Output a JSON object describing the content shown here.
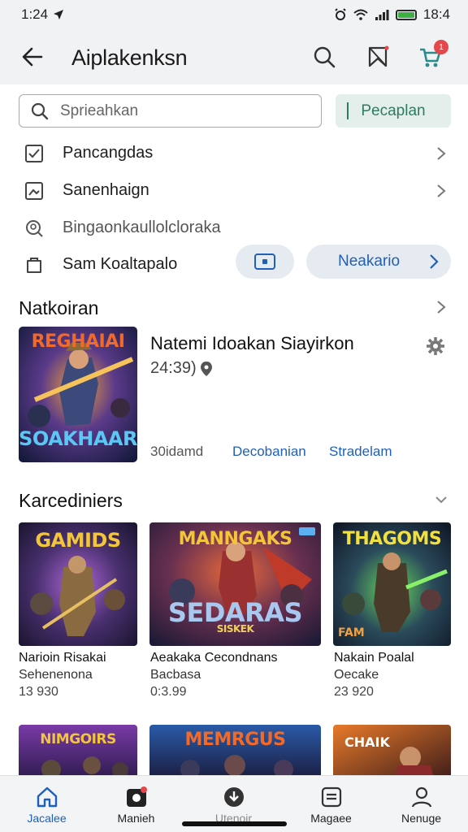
{
  "status": {
    "time_left": "1:24",
    "time_right": "18:4",
    "battery_color": "#3cb043"
  },
  "appbar": {
    "title": "Aiplakenksn",
    "cart_badge": "1",
    "icons": [
      "back-arrow-icon",
      "search-icon",
      "bookmark-icon",
      "cart-icon"
    ]
  },
  "search": {
    "placeholder": "Sprieahkan",
    "button_label": "Pecaplan"
  },
  "menu": [
    {
      "label": "Pancangdas",
      "icon": "checkbox-icon"
    },
    {
      "label": "Sanenhaign",
      "icon": "image-icon"
    },
    {
      "label": "Bingaonkaullolcloraka",
      "icon": "search-person-icon"
    },
    {
      "label": "Sam Koaltapalo",
      "icon": "bag-icon"
    }
  ],
  "pills": {
    "pill2_label": "Neakario"
  },
  "featured": {
    "heading": "Natkoiran",
    "title": "Natemi Idoakan Siayirkon",
    "meta": "24:39)",
    "foot_1": "30idamd",
    "foot_2": "Decobanian",
    "foot_3": "Stradelam",
    "art_top": "REGHAIAI",
    "art_bottom": "SOAKHAAR"
  },
  "collection": {
    "heading": "Karcediniers",
    "cards": [
      {
        "title": "Narioin Risakai",
        "subtitle": "Sehenenona",
        "price": "13 930",
        "art": "GAMIDS"
      },
      {
        "title": "Aeakaka Cecondnans",
        "subtitle": "Bacbasa",
        "price": "0:3.99",
        "art": "MANNGAKS",
        "art2": "SEDARAS",
        "art3": "SISKEK"
      },
      {
        "title": "Nakain Poalal",
        "subtitle": "Oecake",
        "price": "23 920",
        "art": "THAGOMS",
        "art2": "FAM"
      }
    ],
    "row2_art": [
      "NIMGOIRS",
      "MEMRGUS",
      "CHAIK"
    ]
  },
  "bottom_nav": [
    {
      "label": "Jacalee",
      "icon": "home-icon",
      "active": true
    },
    {
      "label": "Manieh",
      "icon": "camera-icon",
      "active": false
    },
    {
      "label": "Utenoir",
      "icon": "download-icon",
      "active": false
    },
    {
      "label": "Magaee",
      "icon": "document-icon",
      "active": false
    },
    {
      "label": "Nenuge",
      "icon": "profile-icon",
      "active": false
    }
  ],
  "colors": {
    "accent": "#1d5fbf",
    "search_button_text": "#2f7a63",
    "search_button_bg": "#e4efeb",
    "badge": "#e5474b"
  }
}
